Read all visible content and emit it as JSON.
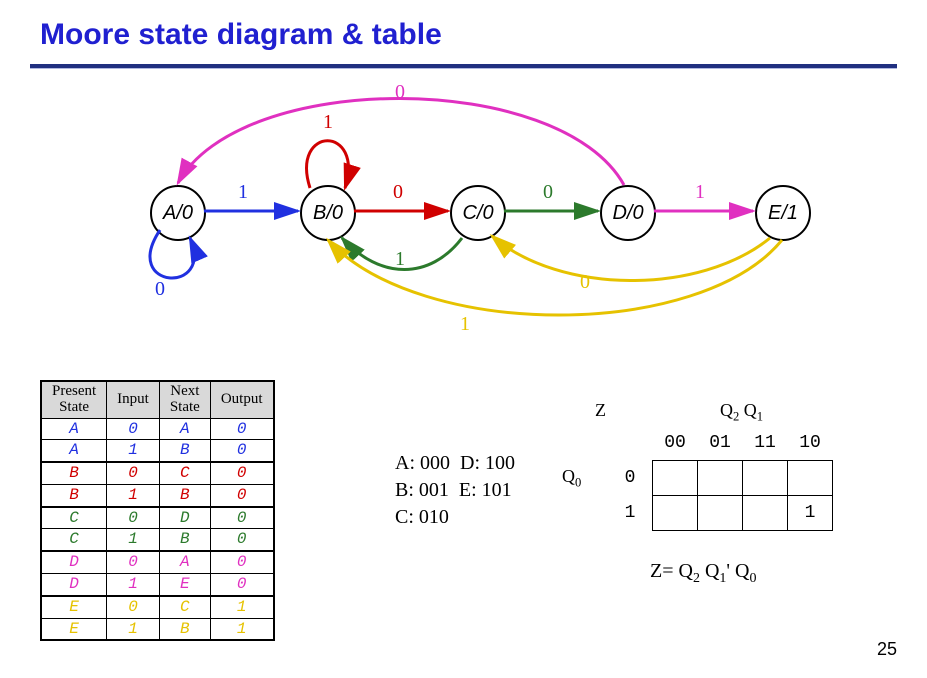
{
  "title": "Moore state diagram & table",
  "page_number": "25",
  "states": {
    "A": "A/0",
    "B": "B/0",
    "C": "C/0",
    "D": "D/0",
    "E": "E/1"
  },
  "transitions": [
    {
      "from": "A",
      "to": "A",
      "input": "0",
      "color": "#2030e0"
    },
    {
      "from": "A",
      "to": "B",
      "input": "1",
      "color": "#2030e0"
    },
    {
      "from": "B",
      "to": "B",
      "input": "1",
      "color": "#d00000"
    },
    {
      "from": "B",
      "to": "C",
      "input": "0",
      "color": "#d00000"
    },
    {
      "from": "C",
      "to": "D",
      "input": "0",
      "color": "#2c7a2c"
    },
    {
      "from": "C",
      "to": "B",
      "input": "1",
      "color": "#2c7a2c"
    },
    {
      "from": "D",
      "to": "E",
      "input": "1",
      "color": "#e030c0"
    },
    {
      "from": "D",
      "to": "A",
      "input": "0",
      "color": "#e030c0"
    },
    {
      "from": "E",
      "to": "C",
      "input": "0",
      "color": "#e6c200"
    },
    {
      "from": "E",
      "to": "B",
      "input": "1",
      "color": "#e6c200"
    }
  ],
  "table": {
    "headers": {
      "present": "Present State",
      "input": "Input",
      "next": "Next State",
      "output": "Output"
    },
    "rows": [
      {
        "ps": "A",
        "in": "0",
        "ns": "A",
        "out": "0",
        "cls": "cellA"
      },
      {
        "ps": "A",
        "in": "1",
        "ns": "B",
        "out": "0",
        "cls": "cellA"
      },
      {
        "ps": "B",
        "in": "0",
        "ns": "C",
        "out": "0",
        "cls": "cellB"
      },
      {
        "ps": "B",
        "in": "1",
        "ns": "B",
        "out": "0",
        "cls": "cellB"
      },
      {
        "ps": "C",
        "in": "0",
        "ns": "D",
        "out": "0",
        "cls": "cellC"
      },
      {
        "ps": "C",
        "in": "1",
        "ns": "B",
        "out": "0",
        "cls": "cellC"
      },
      {
        "ps": "D",
        "in": "0",
        "ns": "A",
        "out": "0",
        "cls": "cellD"
      },
      {
        "ps": "D",
        "in": "1",
        "ns": "E",
        "out": "0",
        "cls": "cellD"
      },
      {
        "ps": "E",
        "in": "0",
        "ns": "C",
        "out": "1",
        "cls": "cellE"
      },
      {
        "ps": "E",
        "in": "1",
        "ns": "B",
        "out": "1",
        "cls": "cellE"
      }
    ]
  },
  "encoding": {
    "line1_left": "A: 000",
    "line1_right": "D: 100",
    "line2_left": "B: 001",
    "line2_right": "E: 101",
    "line3": "C: 010"
  },
  "kmap": {
    "z_label": "Z",
    "cols_label": "Q₂ Q₁",
    "row_label": "Q₀",
    "col_headers": [
      "00",
      "01",
      "11",
      "10"
    ],
    "row_headers": [
      "0",
      "1"
    ],
    "cells": [
      [
        "",
        "",
        "",
        ""
      ],
      [
        "",
        "",
        "",
        "1"
      ]
    ],
    "expr": "Z= Q₂ Q₁' Q₀"
  }
}
